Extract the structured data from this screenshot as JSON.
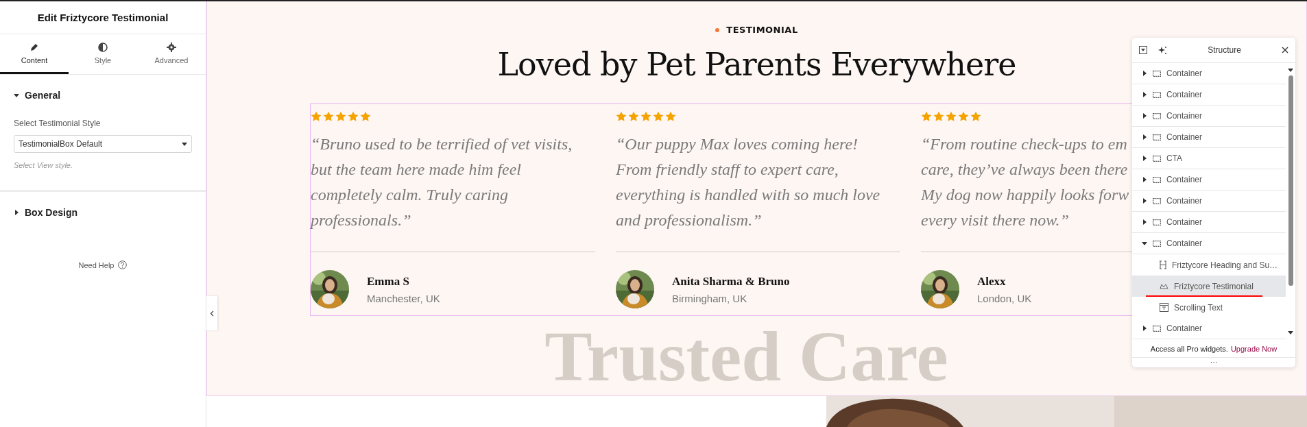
{
  "editor": {
    "title": "Edit Friztycore Testimonial",
    "tabs": [
      {
        "label": "Content",
        "selected": true
      },
      {
        "label": "Style",
        "selected": false
      },
      {
        "label": "Advanced",
        "selected": false
      }
    ],
    "sections": [
      {
        "title": "General",
        "expanded": true,
        "field_label": "Select Testimonial Style",
        "select_value": "TestimonialBox Default",
        "hint": "Select View style."
      },
      {
        "title": "Box Design",
        "expanded": false
      }
    ],
    "help": "Need Help"
  },
  "section": {
    "eyebrow": "TESTIMONIAL",
    "heading": "Loved by Pet Parents Everywhere",
    "testimonials": [
      {
        "stars": 5,
        "quote_lines": [
          "“Bruno used to be terrified of vet visits,",
          "but the team here made him feel",
          "completely calm. Truly caring",
          "professionals.”"
        ],
        "name": "Emma S",
        "location": "Manchester, UK"
      },
      {
        "stars": 5,
        "quote_lines": [
          "“Our puppy Max loves coming here!",
          "From friendly staff to expert care,",
          "everything is handled with so much love",
          "and professionalism.”"
        ],
        "name": "Anita Sharma & Bruno",
        "location": "Birmingham, UK"
      },
      {
        "stars": 5,
        "quote_lines": [
          "“From routine check-ups to em",
          "care, they’ve always been there",
          "My dog now happily looks forw",
          "every visit there now.”"
        ],
        "name": "Alexx",
        "location": "London, UK"
      }
    ],
    "backdrop_text": "Trusted Care"
  },
  "structure": {
    "title": "Structure",
    "items": [
      {
        "label": "Container",
        "kind": "container",
        "expanded": false,
        "selected": false
      },
      {
        "label": "Container",
        "kind": "container",
        "expanded": false,
        "selected": false
      },
      {
        "label": "Container",
        "kind": "container",
        "expanded": false,
        "selected": false
      },
      {
        "label": "Container",
        "kind": "container",
        "expanded": false,
        "selected": false
      },
      {
        "label": "CTA",
        "kind": "container",
        "expanded": false,
        "selected": false
      },
      {
        "label": "Container",
        "kind": "container",
        "expanded": false,
        "selected": false
      },
      {
        "label": "Container",
        "kind": "container",
        "expanded": false,
        "selected": false
      },
      {
        "label": "Container",
        "kind": "container",
        "expanded": false,
        "selected": false
      },
      {
        "label": "Container",
        "kind": "container",
        "expanded": true,
        "selected": false,
        "children": [
          {
            "label": "Friztycore Heading and Su…",
            "kind": "heading",
            "selected": false
          },
          {
            "label": "Friztycore Testimonial",
            "kind": "widget",
            "selected": true
          },
          {
            "label": "Scrolling Text",
            "kind": "text",
            "selected": false
          }
        ]
      },
      {
        "label": "Container",
        "kind": "container",
        "expanded": false,
        "selected": false
      }
    ],
    "footer_text": "Access all Pro widgets.",
    "footer_link": "Upgrade Now",
    "more_label": "···"
  }
}
